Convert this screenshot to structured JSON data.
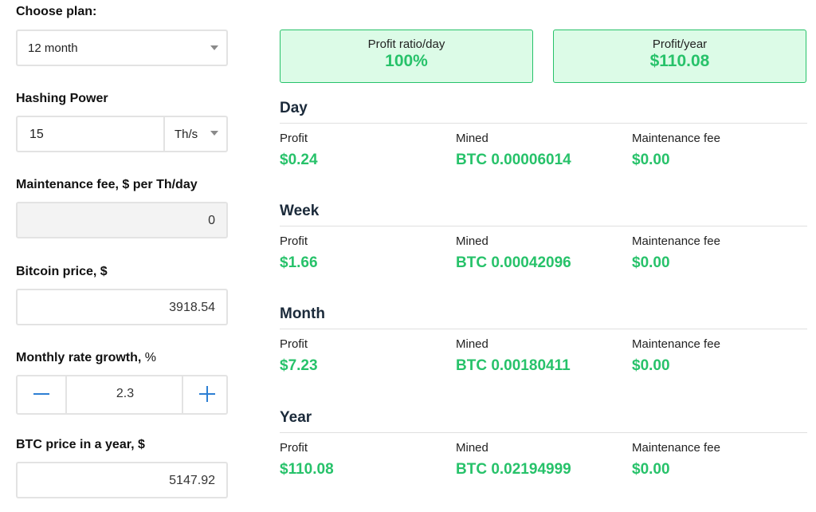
{
  "left_panel": {
    "plan": {
      "label": "Choose plan:",
      "value": "12 month"
    },
    "hashing_power": {
      "label": "Hashing Power",
      "value": "15",
      "unit": "Th/s"
    },
    "maintenance_fee": {
      "label": "Maintenance fee, $ per Th/day",
      "value": "0"
    },
    "bitcoin_price": {
      "label": "Bitcoin price, $",
      "value": "3918.54"
    },
    "monthly_growth": {
      "label": "Monthly rate growth,",
      "label_suffix": "%",
      "value": "2.3"
    },
    "btc_year_price": {
      "label": "BTC price in a year, $",
      "value": "5147.92"
    }
  },
  "summary": {
    "profit_ratio": {
      "label": "Profit ratio/day",
      "value": "100%"
    },
    "profit_year": {
      "label": "Profit/year",
      "value": "$110.08"
    }
  },
  "columns": {
    "profit": "Profit",
    "mined": "Mined",
    "fee": "Maintenance fee"
  },
  "periods": {
    "day": {
      "title": "Day",
      "profit": "$0.24",
      "mined": "BTC 0.00006014",
      "fee": "$0.00"
    },
    "week": {
      "title": "Week",
      "profit": "$1.66",
      "mined": "BTC 0.00042096",
      "fee": "$0.00"
    },
    "month": {
      "title": "Month",
      "profit": "$7.23",
      "mined": "BTC 0.00180411",
      "fee": "$0.00"
    },
    "year": {
      "title": "Year",
      "profit": "$110.08",
      "mined": "BTC 0.02194999",
      "fee": "$0.00"
    }
  },
  "colors": {
    "accent_green": "#27c26a",
    "kpi_bg": "#dcfbe7",
    "stepper_blue": "#2d7fd3"
  }
}
